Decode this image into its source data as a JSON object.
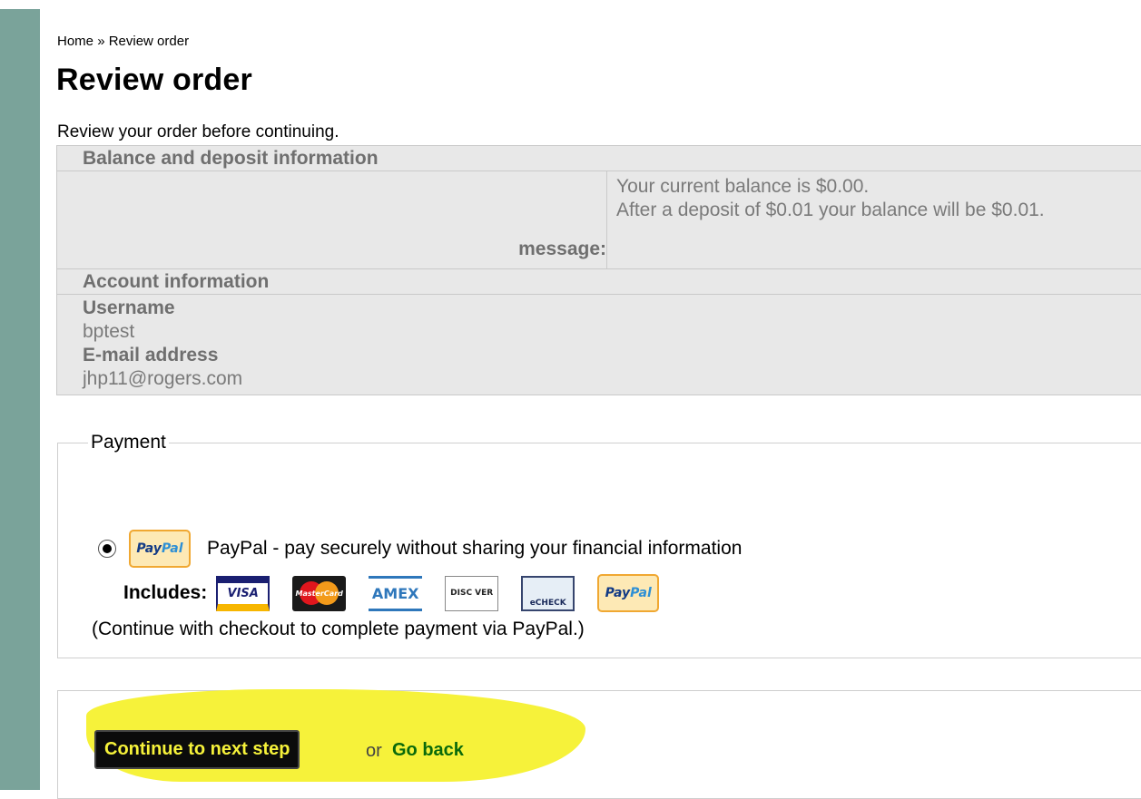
{
  "breadcrumb": {
    "home": "Home",
    "separator": "»",
    "current": "Review order"
  },
  "page": {
    "title": "Review order",
    "intro": "Review your order before continuing."
  },
  "balance_section": {
    "heading": "Balance and deposit information",
    "message_label": "message:",
    "message_line1": "Your current balance is $0.00.",
    "message_line2": "After a deposit of $0.01 your balance will be $0.01."
  },
  "account_section": {
    "heading": "Account information",
    "username_label": "Username",
    "username_value": "bptest",
    "email_label": "E-mail address",
    "email_value": "jhp11@rogers.com"
  },
  "payment": {
    "legend": "Payment",
    "option_selected": true,
    "option_badge": {
      "part1": "Pay",
      "part2": "Pal"
    },
    "option_label": "PayPal - pay securely without sharing your financial information",
    "includes_label": "Includes:",
    "cards": {
      "visa": "VISA",
      "mastercard": "MasterCard",
      "amex": "AMEX",
      "discover": "DISC VER",
      "echeck": "eCHECK",
      "paypal_part1": "Pay",
      "paypal_part2": "Pal"
    },
    "note": "(Continue with checkout to complete payment via PayPal.)"
  },
  "actions": {
    "continue_label": "Continue to next step",
    "or_text": "or",
    "go_back_label": "Go back"
  },
  "colors": {
    "left_stripe": "#7aa39a",
    "table_bg": "#e8e8e8",
    "highlight": "#f6f23a",
    "go_back_link": "#0a6a0a"
  }
}
